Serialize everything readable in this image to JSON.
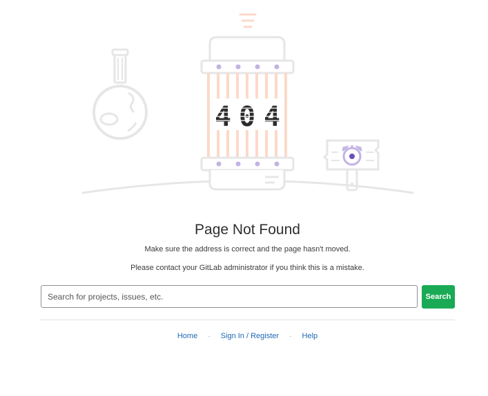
{
  "error": {
    "code_digits": [
      "4",
      "0",
      "4"
    ],
    "title": "Page Not Found",
    "message_1": "Make sure the address is correct and the page hasn't moved.",
    "message_2": "Please contact your GitLab administrator if you think this is a mistake."
  },
  "search": {
    "placeholder": "Search for projects, issues, etc.",
    "button_label": "Search"
  },
  "footer": {
    "links": [
      {
        "label": "Home"
      },
      {
        "label": "Sign In / Register"
      },
      {
        "label": "Help"
      }
    ],
    "separator": "·"
  },
  "colors": {
    "accent_green": "#1aaa55",
    "link_blue": "#1b69b6",
    "illustration_gray": "#e6e6e6",
    "illustration_orange": "#fcd9c9",
    "illustration_purple": "#c3b3e3"
  }
}
